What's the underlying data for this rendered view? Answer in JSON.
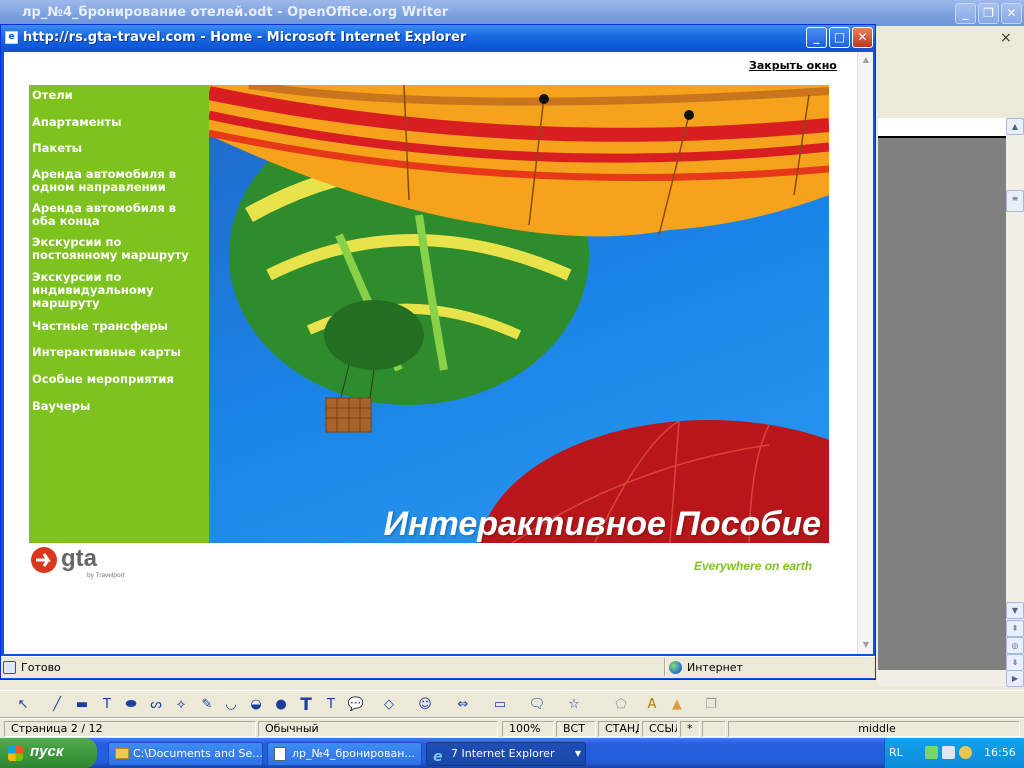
{
  "openoffice": {
    "title": "лр_№4_бронирование отелей.odt - OpenOffice.org Writer",
    "close_glyph": "×",
    "status": {
      "page": "Страница  2 / 12",
      "style": "Обычный",
      "zoom": "100%",
      "insert_mode": "ВСТ",
      "selection_mode": "СТАНД",
      "hyperlink_mode": "ССЫЛ",
      "modified": "*",
      "context": "middle"
    },
    "draw_tools": [
      "select-arrow-icon",
      "line-icon",
      "rectangle-icon",
      "text-line-icon",
      "ellipse-icon",
      "curve-icon",
      "connector-icon",
      "freeform-icon",
      "arc-icon",
      "pie-icon",
      "circle-icon",
      "text-icon",
      "callout-text-icon",
      "speech-icon",
      "diamond-icon",
      "smiley-icon",
      "double-arrow-icon",
      "flowchart-icon",
      "callout-icon",
      "star-icon",
      "points-icon",
      "fontwork-icon",
      "image-icon",
      "extrusion-icon"
    ]
  },
  "ie": {
    "title": "http://rs.gta-travel.com - Home - Microsoft Internet Explorer",
    "status_text": "Готово",
    "zone_text": "Интернет"
  },
  "page": {
    "close_link": "Закрыть окно",
    "nav": [
      "Отели",
      "Апартаменты",
      "Пакеты",
      "Аренда автомобиля в\nодном направлении",
      "Аренда автомобиля в\nоба конца",
      "Экскурсии по\nпостоянному маршруту",
      "Экскурсии по\nиндивидуальному\nмаршруту",
      "Частные трансферы",
      "Интерактивные карты",
      "Особые мероприятия",
      "Ваучеры"
    ],
    "hero_caption": "Интерактивное Пособие",
    "logo_text": "gta",
    "logo_sub": "by Travelport",
    "tagline": "Everywhere on earth",
    "colors": {
      "green": "#7ec21e",
      "sky": "#1a84e6",
      "logo_red": "#d9381e"
    }
  },
  "taskbar": {
    "start": "пуск",
    "items": [
      {
        "label": "C:\\Documents and Se..."
      },
      {
        "label": "лр_№4_бронирован..."
      },
      {
        "label": "7 Internet Explorer"
      }
    ],
    "lang": "RL",
    "clock": "16:56"
  }
}
